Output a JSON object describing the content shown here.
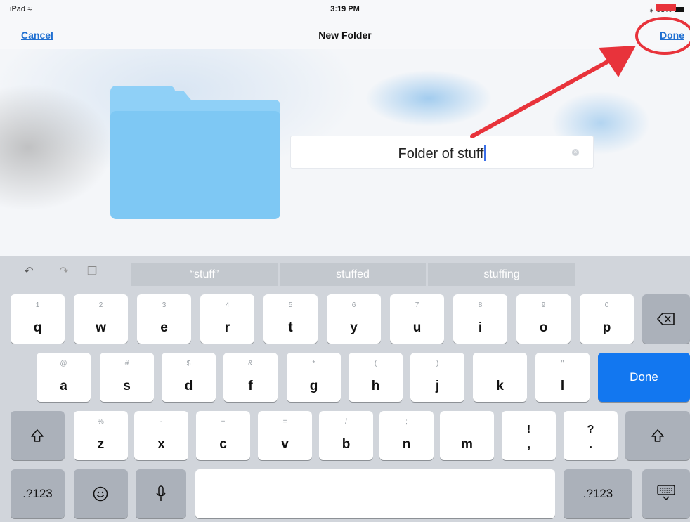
{
  "status": {
    "device": "iPad",
    "time": "3:19 PM",
    "battery": "68%"
  },
  "nav": {
    "cancel": "Cancel",
    "title": "New Folder",
    "done": "Done"
  },
  "folder_name": {
    "value": "Folder of stuff"
  },
  "keyboard": {
    "suggestions": [
      "“stuff”",
      "stuffed",
      "stuffing"
    ],
    "row1": [
      {
        "main": "q",
        "alt": "1"
      },
      {
        "main": "w",
        "alt": "2"
      },
      {
        "main": "e",
        "alt": "3"
      },
      {
        "main": "r",
        "alt": "4"
      },
      {
        "main": "t",
        "alt": "5"
      },
      {
        "main": "y",
        "alt": "6"
      },
      {
        "main": "u",
        "alt": "7"
      },
      {
        "main": "i",
        "alt": "8"
      },
      {
        "main": "o",
        "alt": "9"
      },
      {
        "main": "p",
        "alt": "0"
      }
    ],
    "row2": [
      {
        "main": "a",
        "alt": "@"
      },
      {
        "main": "s",
        "alt": "#"
      },
      {
        "main": "d",
        "alt": "$"
      },
      {
        "main": "f",
        "alt": "&"
      },
      {
        "main": "g",
        "alt": "*"
      },
      {
        "main": "h",
        "alt": "("
      },
      {
        "main": "j",
        "alt": ")"
      },
      {
        "main": "k",
        "alt": "'"
      },
      {
        "main": "l",
        "alt": "\""
      }
    ],
    "row3": [
      {
        "main": "z",
        "alt": "%"
      },
      {
        "main": "x",
        "alt": "-"
      },
      {
        "main": "c",
        "alt": "+"
      },
      {
        "main": "v",
        "alt": "="
      },
      {
        "main": "b",
        "alt": "/"
      },
      {
        "main": "n",
        "alt": ";"
      },
      {
        "main": "m",
        "alt": ":"
      },
      {
        "main": ",",
        "alt": "!"
      },
      {
        "main": ".",
        "alt": "?"
      }
    ],
    "done_key": "Done",
    "numbers_key": ".?123",
    "accent_color": "#1277f0"
  },
  "annotation_color": "#e8333b"
}
